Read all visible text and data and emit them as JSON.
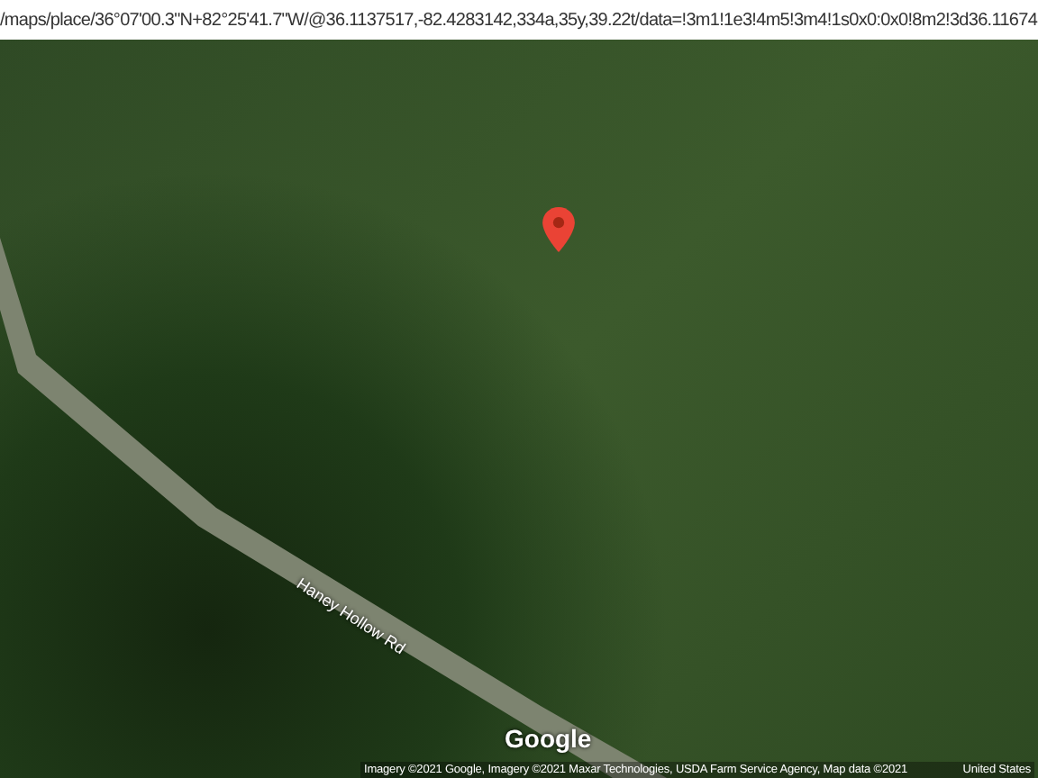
{
  "address_bar": {
    "url": "/maps/place/36°07'00.3\"N+82°25'41.7\"W/@36.1137517,-82.4283142,334a,35y,39.22t/data=!3m1!1e3!4m5!3m4!1s0x0:0x0!8m2!3d36.11674"
  },
  "map": {
    "road_label": "Haney Hollow Rd",
    "logo": "Google",
    "attribution": "Imagery ©2021 Google, Imagery ©2021 Maxar Technologies, USDA Farm Service Agency, Map data ©2021",
    "region": "United States"
  }
}
